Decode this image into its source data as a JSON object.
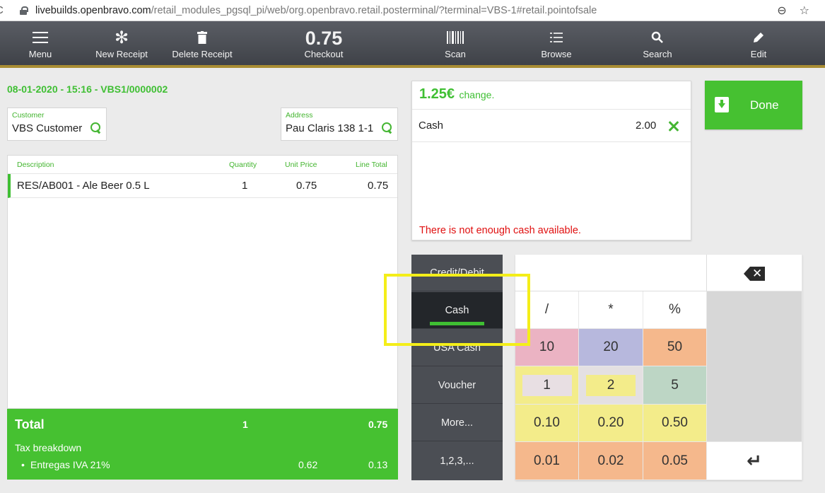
{
  "browser": {
    "reload_glyph": "C",
    "url_host": "livebuilds.openbravo.com",
    "url_path": "/retail_modules_pgsql_pi/web/org.openbravo.retail.posterminal/?terminal=VBS-1#retail.pointofsale",
    "zoom_glyph": "⊖",
    "star_glyph": "☆"
  },
  "toolbar": {
    "menu_label": "Menu",
    "new_receipt_label": "New Receipt",
    "delete_receipt_label": "Delete Receipt",
    "checkout_total": "0.75",
    "checkout_label": "Checkout",
    "scan_label": "Scan",
    "browse_label": "Browse",
    "search_label": "Search",
    "edit_label": "Edit",
    "icons": {
      "new_receipt": "✻",
      "scan": "▥",
      "browse": "☷",
      "search": "⚲",
      "edit": "✎"
    }
  },
  "receipt": {
    "doc_line": "08-01-2020 - 15:16 - VBS1/0000002",
    "customer": {
      "label": "Customer",
      "value": "VBS Customer"
    },
    "address": {
      "label": "Address",
      "value": "Pau Claris 138 1-1"
    },
    "columns": {
      "description": "Description",
      "quantity": "Quantity",
      "unit_price": "Unit Price",
      "line_total": "Line Total"
    },
    "lines": [
      {
        "description": "RES/AB001 - Ale Beer 0.5 L",
        "quantity": "1",
        "unit_price": "0.75",
        "line_total": "0.75"
      }
    ],
    "totals": {
      "total_label": "Total",
      "total_qty": "1",
      "total_amount": "0.75",
      "tax_label": "Tax breakdown",
      "tax_name": "Entregas IVA 21%",
      "tax_base": "0.62",
      "tax_amount": "0.13"
    }
  },
  "payment": {
    "change_amount": "1.25€",
    "change_label": "change.",
    "payments": [
      {
        "method": "Cash",
        "amount": "2.00"
      }
    ],
    "warning": "There is not enough cash available.",
    "done_label": "Done",
    "methods": [
      "Credit/Debit",
      "Cash",
      "USA Cash",
      "Voucher",
      "More...",
      "1,2,3,..."
    ],
    "active_method": "Cash"
  },
  "keypad": {
    "backspace_glyph": "✕",
    "enter_glyph": "↵",
    "ops": [
      "/",
      "*",
      "%"
    ],
    "row_big": [
      "10",
      "20",
      "50"
    ],
    "row_units": [
      "1",
      "2",
      "5"
    ],
    "row_tenths": [
      "0.10",
      "0.20",
      "0.50"
    ],
    "row_cents": [
      "0.01",
      "0.02",
      "0.05"
    ]
  },
  "colors": {
    "brand_green": "#46c131",
    "toolbar_dark": "#4a4d53",
    "warning_red": "#e01010",
    "highlight_yellow": "#f4ee19"
  }
}
